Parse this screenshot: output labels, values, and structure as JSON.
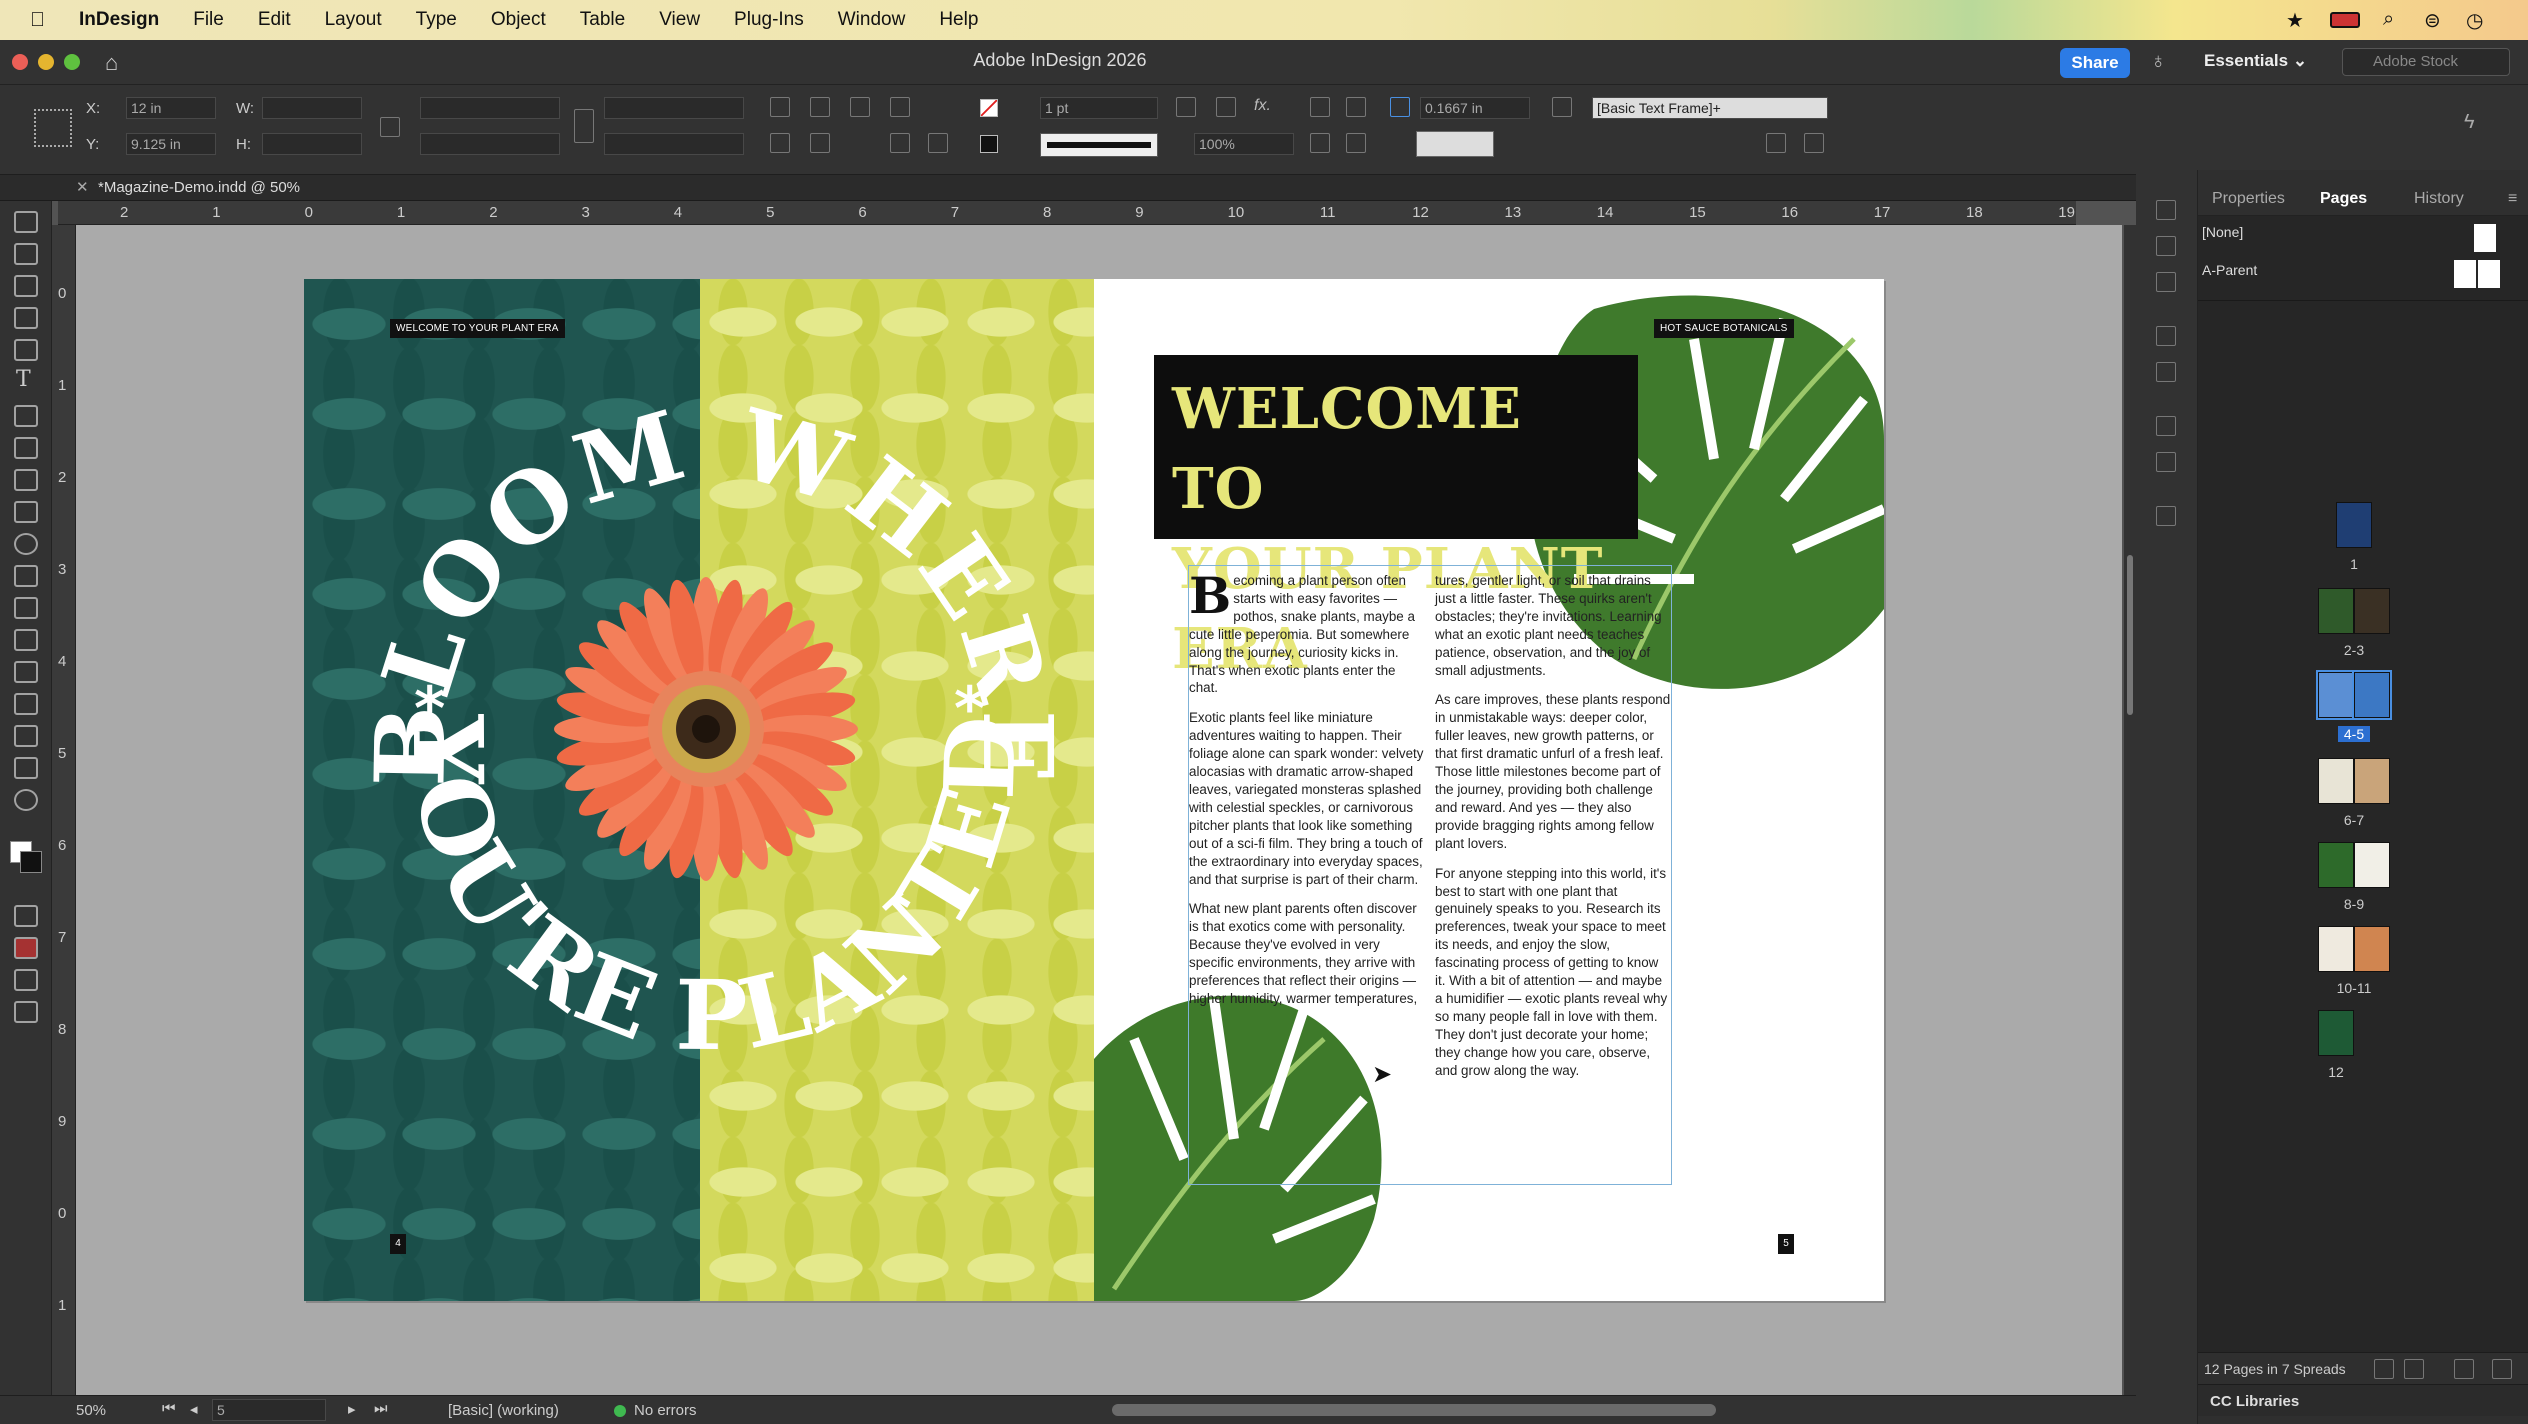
{
  "menubar": {
    "app": "InDesign",
    "items": [
      "File",
      "Edit",
      "Layout",
      "Type",
      "Object",
      "Table",
      "View",
      "Plug-Ins",
      "Window",
      "Help"
    ]
  },
  "window": {
    "title": "Adobe InDesign 2026",
    "share": "Share",
    "workspace": "Essentials",
    "stock_placeholder": "Adobe Stock"
  },
  "control": {
    "x": "12 in",
    "y": "9.125 in",
    "x_label": "X:",
    "y_label": "Y:",
    "w_label": "W:",
    "h_label": "H:",
    "stroke": "1 pt",
    "scale": "100%",
    "offset": "0.1667 in",
    "style": "[Basic Text Frame]+"
  },
  "doc_tab": {
    "title": "*Magazine-Demo.indd @ 50%"
  },
  "ruler": {
    "h": [
      "2",
      "1",
      "0",
      "1",
      "2",
      "3",
      "4",
      "5",
      "6",
      "7",
      "8",
      "9",
      "10",
      "11",
      "12",
      "13",
      "14",
      "15",
      "16",
      "17",
      "18",
      "19"
    ],
    "v": [
      "0",
      "1",
      "2",
      "3",
      "4",
      "5",
      "6",
      "7",
      "8",
      "9",
      "0",
      "1"
    ]
  },
  "left_page": {
    "tag": "WELCOME TO YOUR PLANT ERA",
    "arc_top": "BLOOM WHERE",
    "arc_bottom": "YOU'RE PLANTED",
    "star": "*",
    "folio": "4"
  },
  "right_page": {
    "tag": "HOT SAUCE BOTANICALS",
    "headline1": "WELCOME TO",
    "headline2": "YOUR PLANT ERA",
    "folio": "5",
    "drop": "B",
    "col1": [
      "ecoming a plant person often starts with easy favorites — pothos, snake plants, maybe a cute little peperomia. But somewhere along the journey, curiosity kicks in. That's when exotic plants enter the chat.",
      "Exotic plants feel like miniature adventures waiting to happen. Their foliage alone can spark wonder: velvety alocasias with dramatic arrow-shaped leaves, variegated monsteras splashed with celestial speckles, or carnivorous pitcher plants that look like something out of a sci-fi film. They bring a touch of the extraordinary into everyday spaces, and that surprise is part of their charm.",
      "What new plant parents often discover is that exotics come with personality. Because they've evolved in very specific environments, they arrive with preferences that reflect their origins — higher humidity, warmer temperatures,"
    ],
    "col2": [
      "tures, gentler light, or soil that drains just a little faster. These quirks aren't obstacles; they're invitations. Learning what an exotic plant needs teaches patience, observation, and the joy of small adjustments.",
      "As care improves, these plants respond in unmistakable ways: deeper color, fuller leaves, new growth patterns, or that first dramatic unfurl of a fresh leaf. Those little milestones become part of the journey, providing both challenge and reward. And yes — they also provide bragging rights among fellow plant lovers.",
      "For anyone stepping into this world, it's best to start with one plant that genuinely speaks to you. Research its preferences, tweak your space to meet its needs, and enjoy the slow, fascinating process of getting to know it. With a bit of attention — and maybe a humidifier — exotic plants reveal why so many people fall in love with them. They don't just decorate your home; they change how you care, observe, and grow along the way."
    ]
  },
  "panel": {
    "tabs": [
      "Properties",
      "Pages",
      "History"
    ],
    "none": "[None]",
    "parent": "A-Parent",
    "pages": [
      {
        "label": "1"
      },
      {
        "label": "2-3"
      },
      {
        "label": "4-5"
      },
      {
        "label": "6-7"
      },
      {
        "label": "8-9"
      },
      {
        "label": "10-11"
      },
      {
        "label": "12"
      }
    ],
    "footer": "12 Pages in 7 Spreads",
    "cc": "CC Libraries"
  },
  "status": {
    "zoom": "50%",
    "page": "5",
    "profile": "[Basic] (working)",
    "errors": "No errors"
  },
  "colors": {
    "accent": "#2c7be5",
    "lime": "#d3d95d",
    "teal": "#1f5550",
    "headline": "#e6e67a"
  }
}
